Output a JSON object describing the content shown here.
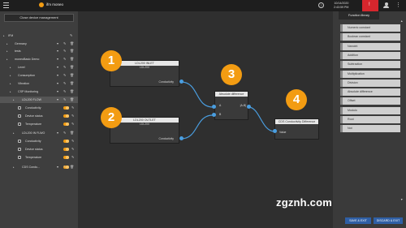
{
  "topbar": {
    "app_title": "ifm moneo",
    "date": "10/14/2020",
    "time": "2:43:59 PM",
    "help_glyph": "?",
    "alert_glyph": "!"
  },
  "sidebar": {
    "close_label": "Close device management",
    "items": [
      {
        "label": "IFM"
      },
      {
        "label": "Germany"
      },
      {
        "label": "tests"
      },
      {
        "label": "moneoBasic Demo"
      },
      {
        "label": "Level"
      },
      {
        "label": "Consumption"
      },
      {
        "label": "Vibration"
      },
      {
        "label": "CSP Monitoring"
      },
      {
        "label": "LDL200 FLOW"
      },
      {
        "label": "Conductivity"
      },
      {
        "label": "Device status"
      },
      {
        "label": "Temperature"
      },
      {
        "label": "LDL200 IN FLWO"
      },
      {
        "label": "Conductivity"
      },
      {
        "label": "Device status"
      },
      {
        "label": "Temperature"
      },
      {
        "label": "CDS Condu..."
      }
    ]
  },
  "palette": {
    "tab_label": "Function library",
    "items": [
      "Numeric constant",
      "Boolean constant",
      "Nanoint",
      "Addition",
      "Subtraction",
      "Multiplication",
      "Division",
      "Absolute difference",
      "Offset",
      "Modulo",
      "Root",
      "Not"
    ]
  },
  "nodes": {
    "n1": {
      "title": "LDL200 INLET",
      "sub": "LDL200",
      "port": "Conductivity"
    },
    "n2": {
      "title": "LDL200 OUTLET",
      "sub": "LDL200",
      "port": "Conductivity"
    },
    "n3": {
      "title": "Absolute difference",
      "in_a": "A",
      "in_b": "B",
      "out": "|A-B|"
    },
    "n4": {
      "title": "CDS Conductivity Difference",
      "in": "Value"
    }
  },
  "badges": [
    "1",
    "2",
    "3",
    "4"
  ],
  "footer": {
    "save": "SAVE & EXIT",
    "discard": "DISCARD & EXIT"
  },
  "watermark": "zgznh.com",
  "colors": {
    "accent": "#f39c12",
    "port": "#4a9ee0",
    "alert": "#d6262d",
    "button": "#2f5fa5"
  }
}
